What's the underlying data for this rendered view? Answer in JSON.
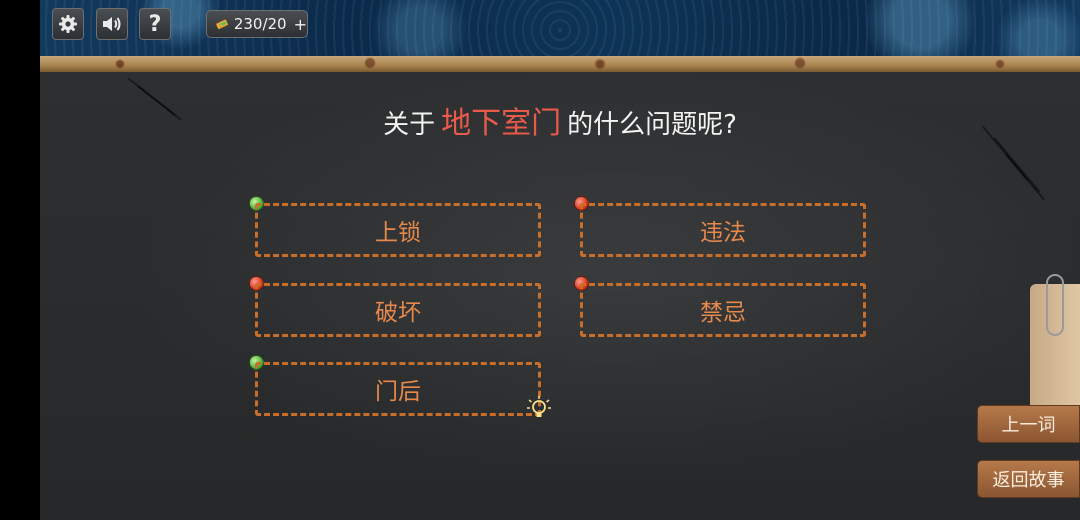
{
  "hud": {
    "settings_icon": "gear-icon",
    "sound_icon": "speaker-icon",
    "help_label": "?",
    "ticket_icon": "ticket-icon",
    "ticket_count": "230/20",
    "add_label": "+"
  },
  "question": {
    "prefix": "关于",
    "topic": "地下室门",
    "suffix": "的什么问题呢?"
  },
  "options": [
    {
      "label": "上锁",
      "status": "green"
    },
    {
      "label": "违法",
      "status": "red"
    },
    {
      "label": "破坏",
      "status": "red"
    },
    {
      "label": "禁忌",
      "status": "red"
    },
    {
      "label": "门后",
      "status": "green"
    }
  ],
  "side": {
    "prev_label": "上一词",
    "back_label": "返回故事"
  },
  "colors": {
    "topic": "#e95a4a",
    "option_text": "#e6894a",
    "option_border": "#c76e2b",
    "dot_green": "#4fb23a",
    "dot_red": "#d83a22"
  }
}
